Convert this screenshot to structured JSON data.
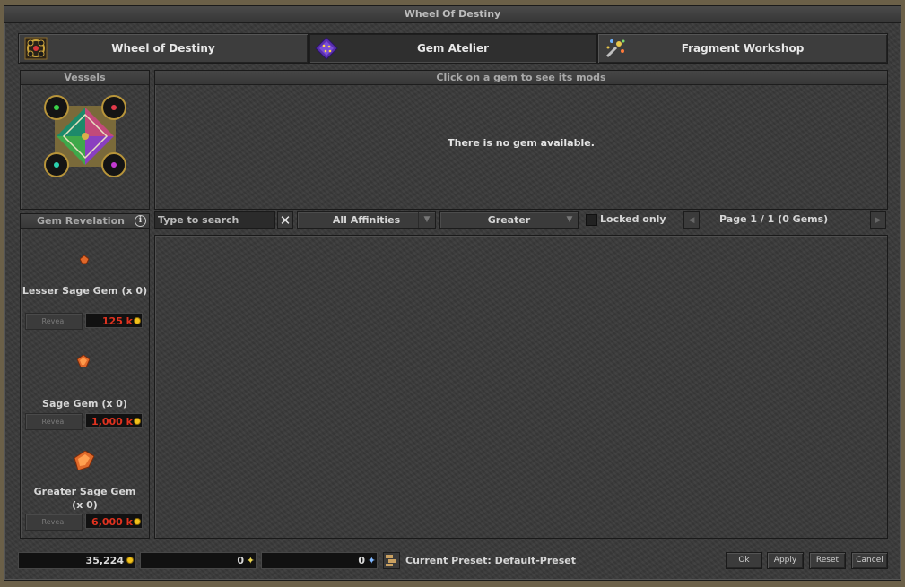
{
  "window": {
    "title": "Wheel Of Destiny"
  },
  "tabs": [
    {
      "label": "Wheel of Destiny",
      "icon": "wheel-icon"
    },
    {
      "label": "Gem Atelier",
      "icon": "gem-atelier-icon"
    },
    {
      "label": "Fragment Workshop",
      "icon": "fragment-workshop-icon"
    }
  ],
  "vessels": {
    "title": "Vessels"
  },
  "gem_mods": {
    "title": "Click on a gem to see its mods",
    "empty_text": "There is no gem available."
  },
  "revelation": {
    "title": "Gem Revelation",
    "gems": [
      {
        "name": "Lesser Sage Gem (x 0)",
        "reveal_label": "Reveal",
        "cost": "125 k"
      },
      {
        "name": "Sage Gem (x 0)",
        "reveal_label": "Reveal",
        "cost": "1,000 k"
      },
      {
        "name": "Greater Sage Gem (x 0)",
        "reveal_label": "Reveal",
        "cost": "6,000 k"
      }
    ]
  },
  "filters": {
    "search_placeholder": "Type to search",
    "affinity": "All Affinities",
    "size": "Greater",
    "locked_label": "Locked only",
    "page": "Page 1 / 1 (0 Gems)"
  },
  "footer": {
    "gold": "35,224",
    "lesser_fragments": "0",
    "greater_fragments": "0",
    "preset": "Current Preset: Default-Preset",
    "ok": "Ok",
    "apply": "Apply",
    "reset": "Reset",
    "cancel": "Cancel"
  },
  "colors": {
    "cost_text": "#e0321f",
    "gold": "#f2c21a"
  }
}
